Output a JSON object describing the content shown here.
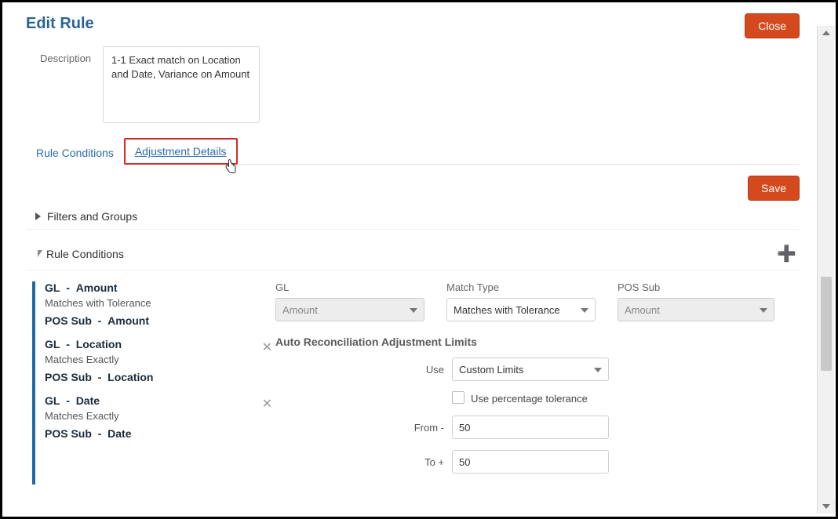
{
  "dialog": {
    "title": "Edit Rule",
    "close": "Close",
    "save": "Save",
    "descriptionLabel": "Description",
    "descriptionValue": "1-1 Exact match on Location and Date, Variance on Amount"
  },
  "tabs": {
    "ruleConditions": "Rule Conditions",
    "adjustmentDetails": "Adjustment Details"
  },
  "sections": {
    "filtersGroups": "Filters and Groups",
    "ruleConditions": "Rule Conditions"
  },
  "ruleList": [
    {
      "src": "GL",
      "srcField": "Amount",
      "match": "Matches with Tolerance",
      "tgt": "POS Sub",
      "tgtField": "Amount",
      "deletable": false
    },
    {
      "src": "GL",
      "srcField": "Location",
      "match": "Matches Exactly",
      "tgt": "POS Sub",
      "tgtField": "Location",
      "deletable": true
    },
    {
      "src": "GL",
      "srcField": "Date",
      "match": "Matches Exactly",
      "tgt": "POS Sub",
      "tgtField": "Date",
      "deletable": true
    }
  ],
  "detail": {
    "glLabel": "GL",
    "glValue": "Amount",
    "matchTypeLabel": "Match Type",
    "matchTypeValue": "Matches with Tolerance",
    "posSubLabel": "POS Sub",
    "posSubValue": "Amount",
    "limitsHeading": "Auto Reconciliation Adjustment Limits",
    "useLabel": "Use",
    "useValue": "Custom Limits",
    "percentLabel": "Use percentage tolerance",
    "fromLabel": "From -",
    "fromValue": "50",
    "toLabel": "To +",
    "toValue": "50"
  }
}
